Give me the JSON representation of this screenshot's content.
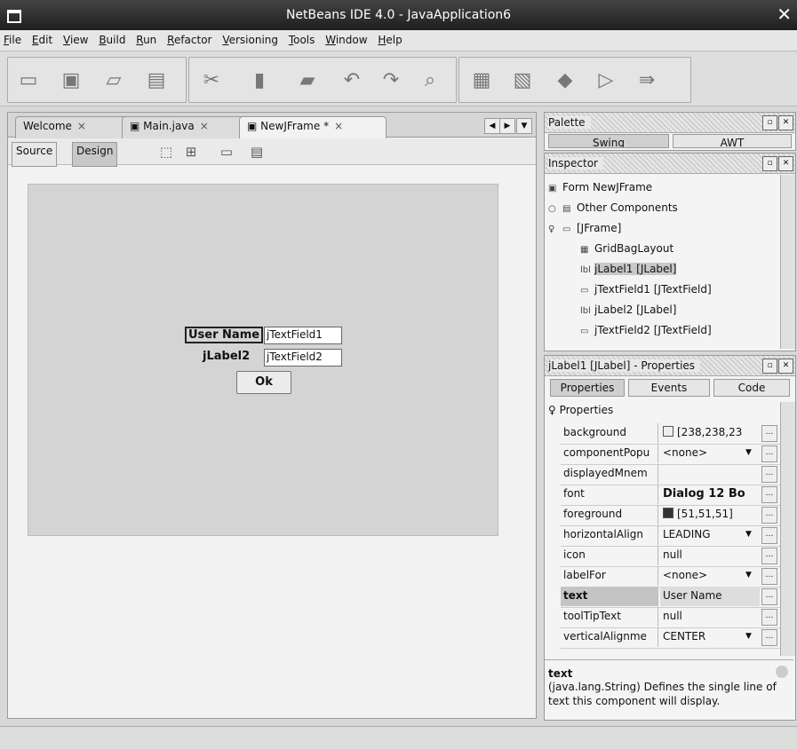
{
  "window": {
    "title": "NetBeans IDE 4.0 - JavaApplication6"
  },
  "menu": [
    "File",
    "Edit",
    "View",
    "Build",
    "Run",
    "Refactor",
    "Versioning",
    "Tools",
    "Window",
    "Help"
  ],
  "toolbar_icons": [
    "new-project-icon",
    "new-file-icon",
    "open-project-icon",
    "save-all-icon",
    "cut-icon",
    "copy-icon",
    "paste-icon",
    "undo-icon",
    "redo-icon",
    "find-icon",
    "build-icon",
    "clean-build-icon",
    "run-icon",
    "debug-icon",
    "step-icon"
  ],
  "editor": {
    "tabs": [
      {
        "label": "Welcome"
      },
      {
        "label": "Main.java"
      },
      {
        "label": "NewJFrame *"
      }
    ],
    "source_label": "Source",
    "design_label": "Design",
    "form": {
      "label1": "User Name",
      "field1": "jTextField1",
      "label2": "jLabel2",
      "field2": "jTextField2",
      "button": "Ok"
    }
  },
  "palette": {
    "title": "Palette",
    "tabs": [
      "Swing",
      "AWT"
    ]
  },
  "inspector": {
    "title": "Inspector",
    "nodes": [
      {
        "label": "Form NewJFrame"
      },
      {
        "label": "Other Components"
      },
      {
        "label": "[JFrame]"
      },
      {
        "label": "GridBagLayout"
      },
      {
        "label": "jLabel1 [JLabel]"
      },
      {
        "label": "jTextField1 [JTextField]"
      },
      {
        "label": "jLabel2 [JLabel]"
      },
      {
        "label": "jTextField2 [JTextField]"
      }
    ]
  },
  "properties": {
    "title": "jLabel1 [JLabel] - Properties",
    "tabs": [
      "Properties",
      "Events",
      "Code"
    ],
    "group": "Properties",
    "rows": [
      {
        "key": "background",
        "value": "[238,238,23"
      },
      {
        "key": "componentPopu",
        "value": "<none>"
      },
      {
        "key": "displayedMnem",
        "value": ""
      },
      {
        "key": "font",
        "value": "Dialog 12 Bo"
      },
      {
        "key": "foreground",
        "value": "[51,51,51]"
      },
      {
        "key": "horizontalAlign",
        "value": "LEADING"
      },
      {
        "key": "icon",
        "value": "null"
      },
      {
        "key": "labelFor",
        "value": "<none>"
      },
      {
        "key": "text",
        "value": "User Name"
      },
      {
        "key": "toolTipText",
        "value": "null"
      },
      {
        "key": "verticalAlignme",
        "value": "CENTER"
      }
    ],
    "help_title": "text",
    "help_text": "(java.lang.String)  Defines the single line of text this component will display."
  },
  "colors": {
    "background_swatch": "#eeeeee",
    "foreground_swatch": "#333333"
  }
}
